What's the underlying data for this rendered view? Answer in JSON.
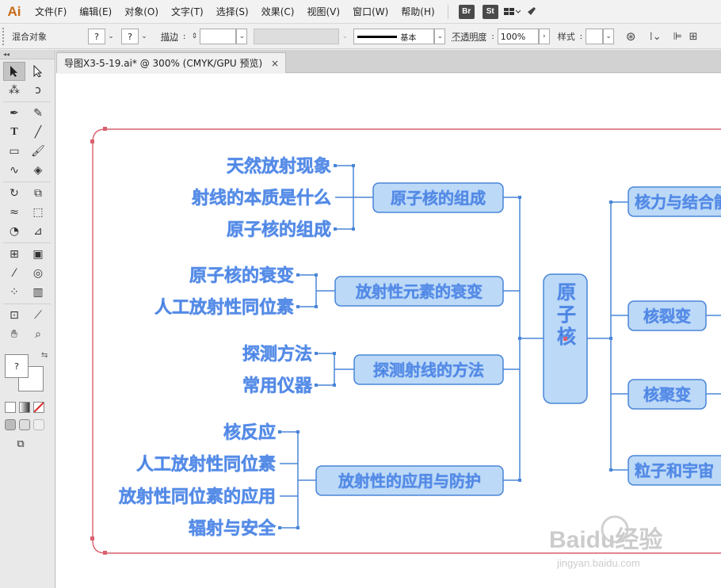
{
  "menubar": {
    "logo": "Ai",
    "items": [
      "文件(F)",
      "编辑(E)",
      "对象(O)",
      "文字(T)",
      "选择(S)",
      "效果(C)",
      "视图(V)",
      "窗口(W)",
      "帮助(H)"
    ],
    "app_icons": [
      "Br",
      "St"
    ]
  },
  "controlbar": {
    "selection_label": "混合对象",
    "fill_value": "?",
    "stroke_value": "?",
    "stroke_label": "描边",
    "stroke_style": "基本",
    "opacity_label": "不透明度",
    "opacity_value": "100%",
    "style_label": "样式"
  },
  "document": {
    "tab_title": "导图X3-5-19.ai* @ 300% (CMYK/GPU 预览)",
    "tab_close": "×"
  },
  "toolbar": {
    "collapse": "◂◂",
    "fill_stroke_unknown": "?"
  },
  "mindmap": {
    "center": "原子核",
    "left_branches": [
      {
        "label": "原子核的组成",
        "leaves": [
          "天然放射现象",
          "射线的本质是什么",
          "原子核的组成"
        ]
      },
      {
        "label": "放射性元素的衰变",
        "leaves": [
          "原子核的衰变",
          "人工放射性同位素"
        ]
      },
      {
        "label": "探测射线的方法",
        "leaves": [
          "探测方法",
          "常用仪器"
        ]
      },
      {
        "label": "放射性的应用与防护",
        "leaves": [
          "核反应",
          "人工放射性同位素",
          "放射性同位素的应用",
          "辐射与安全"
        ]
      }
    ],
    "right_branches": [
      "核力与结合能",
      "核裂变",
      "核聚变",
      "粒子和宇宙"
    ]
  },
  "watermark": {
    "brand": "Baidu经验",
    "url": "jingyan.baidu.com"
  },
  "colors": {
    "accent_blue": "#4a86d8",
    "node_fill": "#bcd9f7",
    "frame_red": "#d9606e",
    "logo_orange": "#c86b18"
  }
}
